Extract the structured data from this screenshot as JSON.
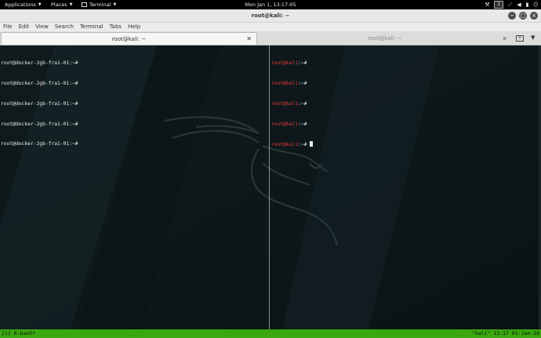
{
  "topbar": {
    "applications": "Applications",
    "places": "Places",
    "terminal": "Terminal",
    "clock": "Mon Jan  1, 13:17:05",
    "workspace": "1",
    "tray_icons": [
      "tools-icon",
      "network-icon",
      "volume-icon",
      "battery-icon",
      "power-icon"
    ]
  },
  "window": {
    "title": "root@kali: ~"
  },
  "menubar": {
    "items": [
      "File",
      "Edit",
      "View",
      "Search",
      "Terminal",
      "Tabs",
      "Help"
    ]
  },
  "tabs": [
    {
      "label": "root@kali: ~",
      "active": true
    },
    {
      "label": "root@kali: ~",
      "active": false
    }
  ],
  "panes": {
    "left_lines": [
      "root@docker-2gb-fra1-01:~#",
      "root@docker-2gb-fra1-01:~#",
      "root@docker-2gb-fra1-01:~#",
      "root@docker-2gb-fra1-01:~#",
      "root@docker-2gb-fra1-01:~#"
    ],
    "right_user": "root@kali",
    "right_suffix": ":~#",
    "right_line_count": 5
  },
  "status": {
    "left": "[1] 0:bash*",
    "right": "\"kali\" 13:17 01-Jan-18"
  },
  "colors": {
    "prompt_user": "#e53b3b",
    "status_bar": "#3aa80f"
  }
}
